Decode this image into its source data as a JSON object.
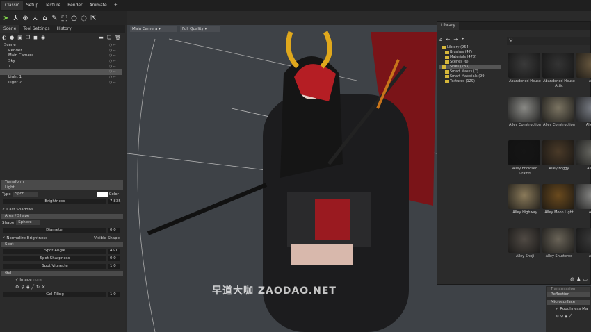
{
  "menu": {
    "tabs": [
      "Classic",
      "Setup",
      "Texture",
      "Render",
      "Animate",
      "+"
    ]
  },
  "toolbar": {
    "icons": [
      "select-arrow-icon",
      "move-icon",
      "rotate-icon",
      "scale-icon",
      "paint-icon",
      "picker-icon",
      "marquee-icon",
      "circle-select-icon",
      "lasso-icon",
      "transform-icon"
    ]
  },
  "left_panel": {
    "tabs": [
      "Scene",
      "Tool Settings",
      "History"
    ],
    "tree": [
      {
        "label": "Scene"
      },
      {
        "label": "Render"
      },
      {
        "label": "Main Camera"
      },
      {
        "label": "Sky"
      },
      {
        "label": "1"
      },
      {
        "label": ""
      },
      {
        "label": "Light 1"
      },
      {
        "label": "Light 2"
      }
    ],
    "sections": {
      "transform": "Transform",
      "light": "Light",
      "area": "Area / Shape",
      "spot": "Spot",
      "gel": "Gel"
    },
    "light": {
      "type_label": "Type",
      "type_value": "Spot",
      "color_label": "Color",
      "brightness_label": "Brightness",
      "brightness_value": "7.835",
      "cast_shadows": "Cast Shadows"
    },
    "area": {
      "shape_label": "Shape",
      "shape_value": "Sphere",
      "diameter_label": "Diameter",
      "diameter_value": "0.0",
      "normalize": "Normalize Brightness",
      "visible_shape": "Visible Shape"
    },
    "spot": {
      "angle_label": "Spot Angle",
      "angle_value": "45.0",
      "sharpness_label": "Spot Sharpness",
      "sharpness_value": "0.0",
      "vignette_label": "Spot Vignette",
      "vignette_value": "1.0"
    },
    "gel": {
      "image_label": "Image",
      "image_value": "none",
      "tiling_label": "Gel Tiling",
      "tiling_value": "1.0"
    }
  },
  "viewport": {
    "camera": "Main Camera",
    "quality": "Full Quality"
  },
  "library": {
    "title": "Library",
    "tree": [
      {
        "label": "Library (954)"
      },
      {
        "label": "Brushes (47)"
      },
      {
        "label": "Materials (478)"
      },
      {
        "label": "Scenes (6)"
      },
      {
        "label": "Skies (283)",
        "selected": true
      },
      {
        "label": "Smart Masks (7)"
      },
      {
        "label": "Smart Materials (99)"
      },
      {
        "label": "Textures (129)"
      }
    ],
    "items": [
      {
        "label": "Abandoned House",
        "color": "#3a3a3a"
      },
      {
        "label": "Abandoned House Attic",
        "color": "#343434"
      },
      {
        "label": "Alley",
        "color": "#6b5a40"
      },
      {
        "label": "Alley Construction",
        "color": "#8a8a86"
      },
      {
        "label": "Alley Construction",
        "color": "#7b7462"
      },
      {
        "label": "Alley Co",
        "color": "#7c8088"
      },
      {
        "label": "Alley Enclosed Graffiti",
        "color": "#151515"
      },
      {
        "label": "Alley Foggy",
        "color": "#4a3a28"
      },
      {
        "label": "Alley G",
        "color": "#6a6a64"
      },
      {
        "label": "Alley Highway",
        "color": "#8a7a5a"
      },
      {
        "label": "Alley Moon Light",
        "color": "#6a4a1e"
      },
      {
        "label": "Alley",
        "color": "#8a8a88"
      },
      {
        "label": "Alley Shoji",
        "color": "#504a44"
      },
      {
        "label": "Alley Shuttered",
        "color": "#6a6458"
      },
      {
        "label": "Alley",
        "color": "#3a3a3a"
      }
    ]
  },
  "bottom_right": {
    "sections": [
      "Transmission",
      "Reflection",
      "Microsurface"
    ],
    "roughness": "Roughness Ma"
  },
  "watermark": "早道大咖 ZAODAO.NET"
}
